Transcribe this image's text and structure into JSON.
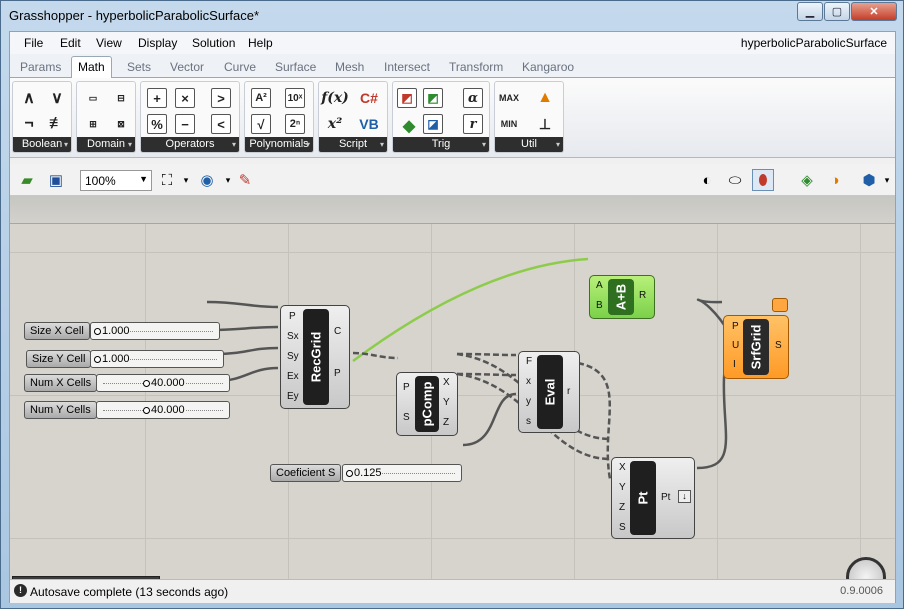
{
  "window": {
    "title": "Grasshopper - hyperbolicParabolicSurface*",
    "document_name": "hyperbolicParabolicSurface"
  },
  "menu": [
    "File",
    "Edit",
    "View",
    "Display",
    "Solution",
    "Help"
  ],
  "tabs": [
    "Params",
    "Math",
    "Sets",
    "Vector",
    "Curve",
    "Surface",
    "Mesh",
    "Intersect",
    "Transform",
    "Kangaroo"
  ],
  "active_tab": "Math",
  "ribbon_groups": [
    "Boolean",
    "Domain",
    "Operators",
    "Polynomials",
    "Script",
    "Trig",
    "Util"
  ],
  "ribbon_icons": {
    "boolean": [
      "∧",
      "∨",
      "¬",
      "≢"
    ],
    "operators": [
      "+",
      "×",
      ">",
      "%",
      "−",
      "<"
    ],
    "polynomials": [
      "A²",
      "10ˣ",
      "√",
      "2ⁿ"
    ],
    "script": [
      "f(x)",
      "C#",
      "x²",
      "VB"
    ],
    "trig": [
      "α",
      "r"
    ],
    "util": [
      "MAX",
      "MIN"
    ]
  },
  "zoom": "100%",
  "sliders": [
    {
      "label": "Size X Cell",
      "value": "1.000"
    },
    {
      "label": "Size Y Cell",
      "value": "1.000"
    },
    {
      "label": "Num X Cells",
      "value": "40.000"
    },
    {
      "label": "Num Y Cells",
      "value": "40.000"
    },
    {
      "label": "Coeficient S",
      "value": "0.125"
    }
  ],
  "components": {
    "recgrid": {
      "name": "RecGrid",
      "inputs": [
        "P",
        "Sx",
        "Sy",
        "Ex",
        "Ey"
      ],
      "outputs": [
        "C",
        "P"
      ]
    },
    "pcomp": {
      "name": "pComp",
      "inputs": [
        "P",
        "S"
      ],
      "outputs": [
        "X",
        "Y",
        "Z"
      ]
    },
    "eval": {
      "name": "Eval",
      "inputs": [
        "F",
        "x",
        "y",
        "s"
      ],
      "outputs": [
        "r"
      ]
    },
    "addition": {
      "name": "A+B",
      "inputs": [
        "A",
        "B"
      ],
      "outputs": [
        "R"
      ]
    },
    "srfgrid": {
      "name": "SrfGrid",
      "inputs": [
        "P",
        "U",
        "I"
      ],
      "outputs": [
        "S"
      ]
    },
    "pt": {
      "name": "Pt",
      "inputs": [
        "X",
        "Y",
        "Z",
        "S"
      ],
      "outputs": [
        "Pt"
      ]
    }
  },
  "status": {
    "message": "Autosave complete (13 seconds ago)",
    "version": "0.9.0006"
  },
  "colors": {
    "canvas": "#d6d4cd",
    "green_component": "#7bd14a",
    "orange_component": "#ff9a26",
    "wire_green": "#8dcc4a"
  }
}
